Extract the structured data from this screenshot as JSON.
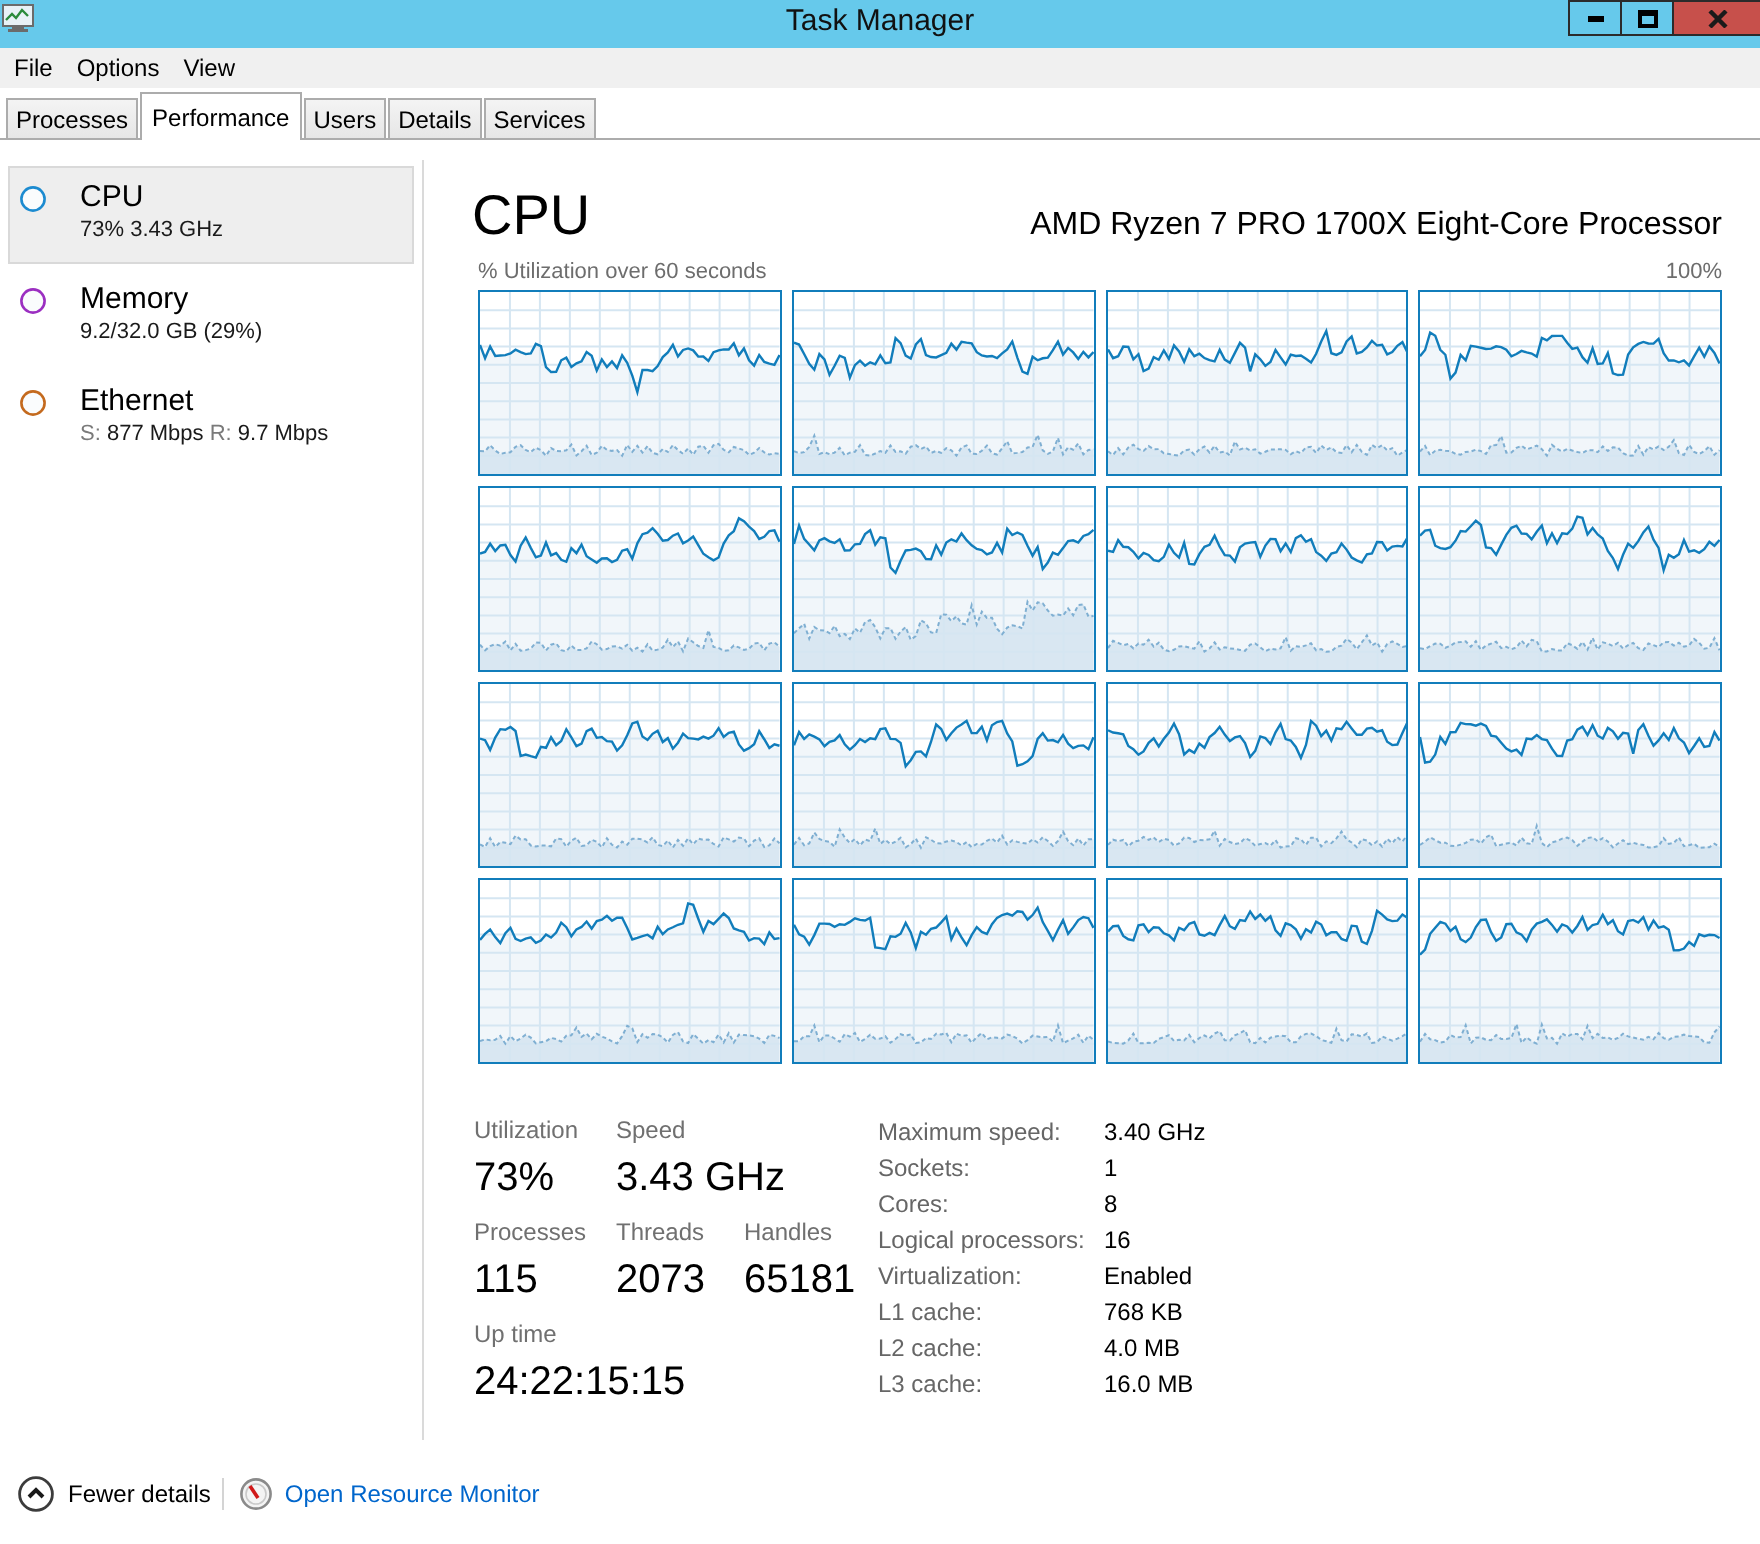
{
  "window": {
    "title": "Task Manager"
  },
  "menu": [
    {
      "label": "File"
    },
    {
      "label": "Options"
    },
    {
      "label": "View"
    }
  ],
  "tabs": [
    {
      "label": "Processes",
      "selected": false
    },
    {
      "label": "Performance",
      "selected": true
    },
    {
      "label": "Users",
      "selected": false
    },
    {
      "label": "Details",
      "selected": false
    },
    {
      "label": "Services",
      "selected": false
    }
  ],
  "sidebar": {
    "items": [
      {
        "title": "CPU",
        "selected": true,
        "color": "#1c8bd0",
        "detail": [
          {
            "value": "73% 3.43 GHz"
          }
        ]
      },
      {
        "title": "Memory",
        "selected": false,
        "color": "#9b2fc1",
        "detail": [
          {
            "value": "9.2/32.0 GB (29%)"
          }
        ]
      },
      {
        "title": "Ethernet",
        "selected": false,
        "color": "#c46a1e",
        "detail": [
          {
            "label": "S:",
            "value": "877 Mbps"
          },
          {
            "label": "R:",
            "value": "9.7 Mbps"
          }
        ]
      }
    ]
  },
  "performance": {
    "title": "CPU",
    "device": "AMD Ryzen 7 PRO 1700X Eight-Core Processor",
    "graph_caption": "% Utilization over 60 seconds",
    "graph_max": "100%",
    "stats": [
      [
        {
          "label": "Utilization",
          "value": "73%"
        },
        {
          "label": "Speed",
          "value": "3.43 GHz"
        }
      ],
      [
        {
          "label": "Processes",
          "value": "115"
        },
        {
          "label": "Threads",
          "value": "2073"
        },
        {
          "label": "Handles",
          "value": "65181"
        }
      ],
      [
        {
          "label": "Up time",
          "value": "24:22:15:15"
        }
      ]
    ],
    "specs": [
      {
        "label": "Maximum speed:",
        "value": "3.40 GHz"
      },
      {
        "label": "Sockets:",
        "value": "1"
      },
      {
        "label": "Cores:",
        "value": "8"
      },
      {
        "label": "Logical processors:",
        "value": "16"
      },
      {
        "label": "Virtualization:",
        "value": "Enabled"
      },
      {
        "label": "L1 cache:",
        "value": "768 KB"
      },
      {
        "label": "L2 cache:",
        "value": "4.0 MB"
      },
      {
        "label": "L3 cache:",
        "value": "16.0 MB"
      }
    ]
  },
  "footer": {
    "toggle": "Fewer details",
    "link": "Open Resource Monitor"
  }
}
